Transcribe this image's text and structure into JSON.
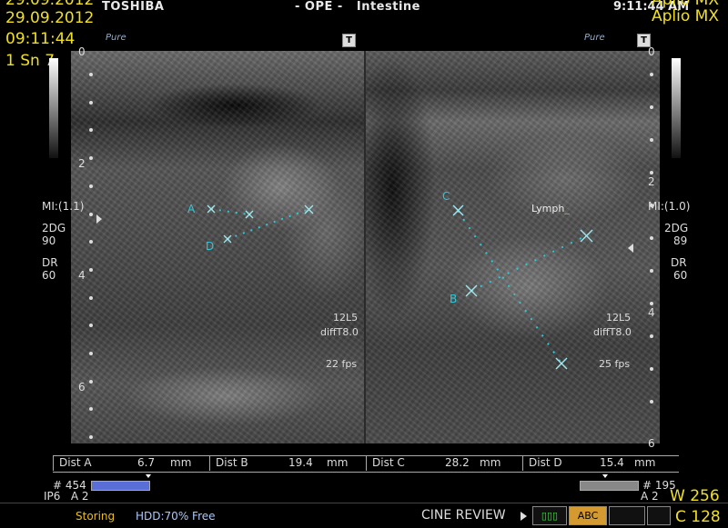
{
  "header": {
    "brand": "TOSHIBA",
    "exam_title": "- OPE -   Intestine",
    "time_top": "9:11:44 AM",
    "date_partial": "29.09.2012",
    "date": "29.09.2012",
    "time": "09:11:44",
    "scan_label": "1 Sn 7",
    "model": "Aplio MX",
    "model_partial": "Aplio MX",
    "pure_left": "Pure",
    "pure_right": "Pure",
    "t_left": "T",
    "t_right": "T"
  },
  "left_panel": {
    "scale": [
      "0",
      "2",
      "4",
      "6"
    ],
    "mi": "MI:(1.1)",
    "mode": "2DG",
    "gain": "90",
    "dr_label": "DR",
    "dr_value": "60",
    "probe": "12L5",
    "filter": "diffT8.0",
    "fps": "22 fps",
    "marker_a": "A",
    "marker_d": "D"
  },
  "right_panel": {
    "scale": [
      "0",
      "2",
      "4",
      "6"
    ],
    "mi": "MI:(1.0)",
    "mode": "2DG",
    "gain": "89",
    "dr_label": "DR",
    "dr_value": "60",
    "probe": "12L5",
    "filter": "diffT8.0",
    "fps": "25 fps",
    "marker_c": "C",
    "marker_b": "B",
    "lymph_label": "Lymph"
  },
  "measurements": [
    {
      "label": "Dist  A",
      "value": "6.7",
      "unit": "mm"
    },
    {
      "label": "Dist  B",
      "value": "19.4",
      "unit": "mm"
    },
    {
      "label": "Dist  C",
      "value": "28.2",
      "unit": "mm"
    },
    {
      "label": "Dist  D",
      "value": "15.4",
      "unit": "mm"
    }
  ],
  "footer": {
    "frame_left": "# 454",
    "frame_right": "# 195",
    "ip_left": "IP6   A 2",
    "ip_right": "A 2",
    "storing": "Storing",
    "hdd": "HDD:70% Free",
    "cine_review": "CINE REVIEW",
    "abc": "ABC",
    "window": "W 256",
    "center": "C 128"
  },
  "colors": {
    "accent_yellow": "#f0e020",
    "caliper_cyan": "#30c8d8",
    "storing_orange": "#f0c000"
  }
}
